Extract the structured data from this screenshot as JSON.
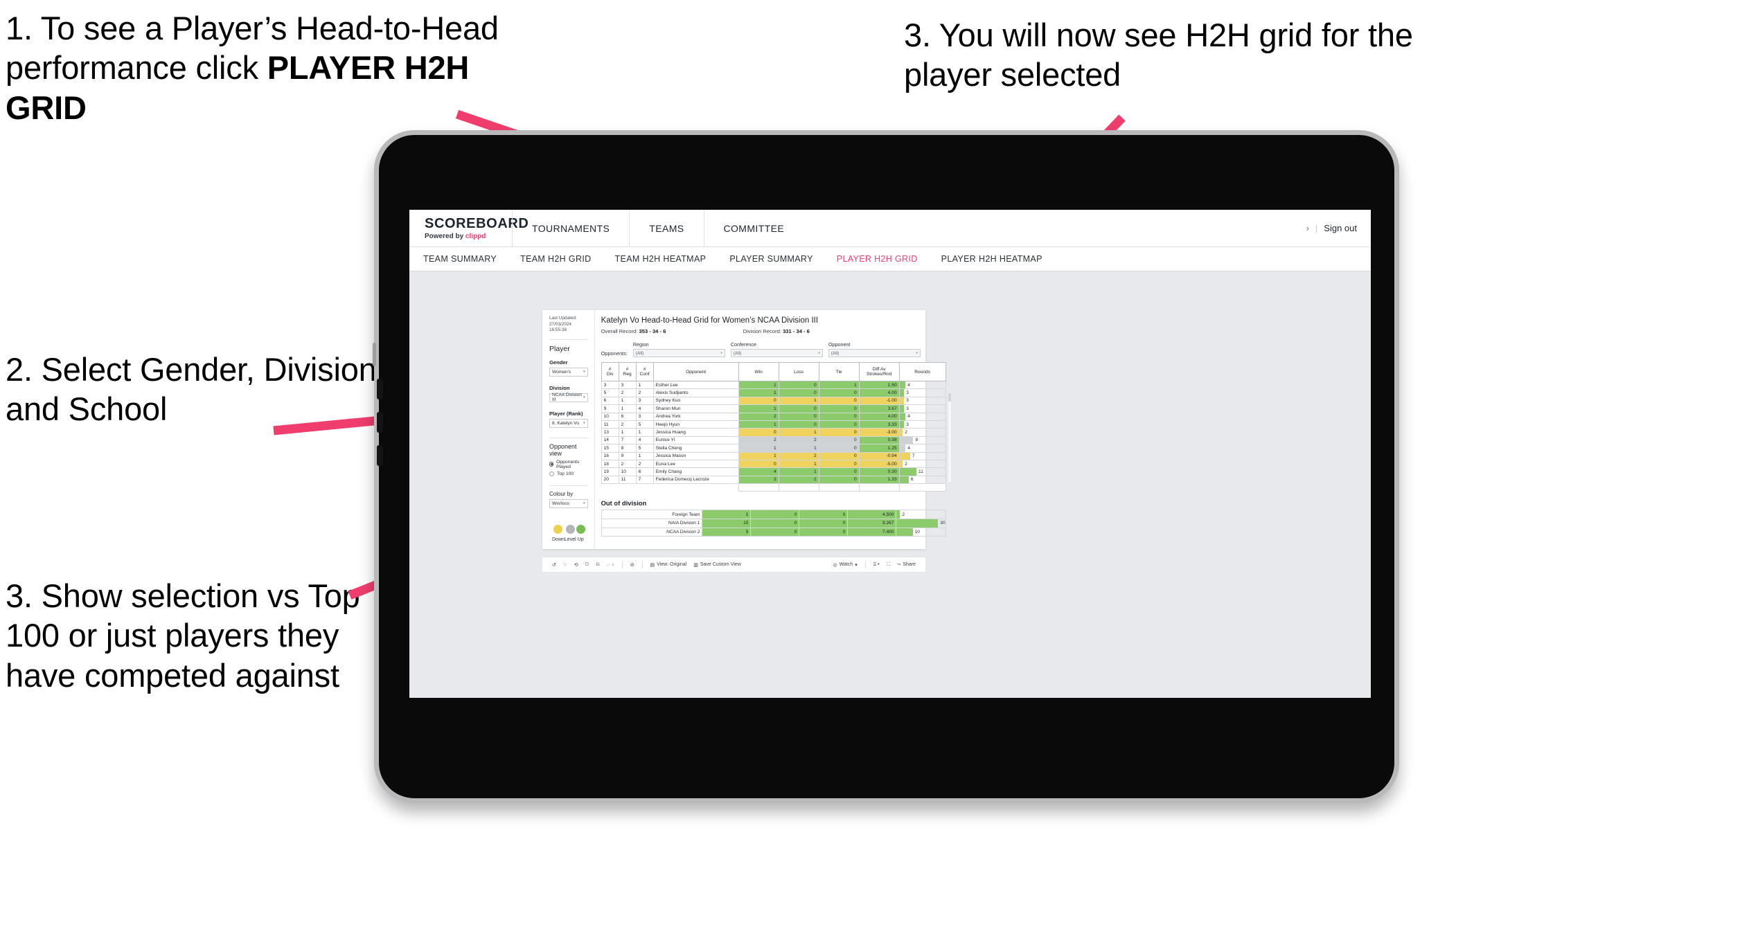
{
  "annotations": [
    {
      "id": "note-1",
      "text_plain": "1. To see a Player’s Head-to-Head performance click ",
      "text_bold": "PLAYER H2H GRID"
    },
    {
      "id": "note-2",
      "text": "3. You will now see H2H grid for the player selected"
    },
    {
      "id": "note-3",
      "text": "2. Select Gender, Division and School"
    },
    {
      "id": "note-4",
      "text": "3. Show selection vs Top 100 or just players they have competed against"
    }
  ],
  "accent_pink": "#ef3e6d",
  "app": {
    "brand": {
      "name": "SCOREBOARD",
      "powered_prefix": "Powered by",
      "powered_brand": "clippd"
    },
    "top_nav": [
      {
        "label": "TOURNAMENTS"
      },
      {
        "label": "TEAMS"
      },
      {
        "label": "COMMITTEE"
      }
    ],
    "top_right": {
      "chevron": "›",
      "separator": "|",
      "sign_out": "Sign out"
    },
    "sub_nav": [
      {
        "label": "TEAM SUMMARY",
        "active": false
      },
      {
        "label": "TEAM H2H GRID",
        "active": false
      },
      {
        "label": "TEAM H2H HEATMAP",
        "active": false
      },
      {
        "label": "PLAYER SUMMARY",
        "active": false
      },
      {
        "label": "PLAYER H2H GRID",
        "active": true
      },
      {
        "label": "PLAYER H2H HEATMAP",
        "active": false
      }
    ]
  },
  "filters": {
    "last_updated_line1": "Last Updated: 27/03/2024",
    "last_updated_line2": "16:55:38",
    "player_heading": "Player",
    "gender": {
      "label": "Gender",
      "value": "Women's"
    },
    "division": {
      "label": "Division",
      "value": "NCAA Division III"
    },
    "player_rank": {
      "label": "Player (Rank)",
      "value": "8. Katelyn Vo"
    },
    "opponent_view": {
      "heading": "Opponent view",
      "options": [
        {
          "label": "Opponents Played",
          "selected": true
        },
        {
          "label": "Top 100",
          "selected": false
        }
      ]
    },
    "colour_by": {
      "label": "Colour by",
      "value": "Win/loss"
    },
    "legend": [
      {
        "label": "Down",
        "color": "#ecd24a"
      },
      {
        "label": "Level",
        "color": "#b4b7ba"
      },
      {
        "label": "Up",
        "color": "#76bd53"
      }
    ]
  },
  "view": {
    "title": "Katelyn Vo Head-to-Head Grid for Women’s NCAA Division III",
    "overall_record_label": "Overall Record:",
    "overall_record_value": "353 - 34 - 6",
    "division_record_label": "Division Record:",
    "division_record_value": "331 - 34 - 6",
    "opponents_label": "Opponents:",
    "opponent_filters": [
      {
        "label": "Region",
        "value": "(All)"
      },
      {
        "label": "Conference",
        "value": "(All)"
      },
      {
        "label": "Opponent",
        "value": "(All)"
      }
    ],
    "out_of_division_heading": "Out of division"
  },
  "chart_data": {
    "type": "table",
    "title": "Katelyn Vo Head-to-Head Grid for Women’s NCAA Division III",
    "columns": [
      "# Div",
      "# Reg",
      "# Conf",
      "Opponent",
      "Win",
      "Loss",
      "Tie",
      "Diff Av Strokes/Rnd",
      "Rounds"
    ],
    "column_header_lines": [
      [
        "#",
        "Div"
      ],
      [
        "#",
        "Reg"
      ],
      [
        "#",
        "Conf"
      ],
      [
        "Opponent"
      ],
      [
        "Win"
      ],
      [
        "Loss"
      ],
      [
        "Tie"
      ],
      [
        "Diff Av",
        "Strokes/Rnd"
      ],
      [
        "Rounds"
      ]
    ],
    "rounds_max": 30,
    "rows": [
      {
        "div": "3",
        "reg": "3",
        "conf": "1",
        "opponent": "Esther Lee",
        "win": "1",
        "loss": "0",
        "tie": "1",
        "diff": "1.50",
        "rounds": 4,
        "status": "up"
      },
      {
        "div": "5",
        "reg": "2",
        "conf": "2",
        "opponent": "Alexis Sudjianto",
        "win": "1",
        "loss": "0",
        "tie": "0",
        "diff": "4.00",
        "rounds": 3,
        "status": "up"
      },
      {
        "div": "6",
        "reg": "1",
        "conf": "3",
        "opponent": "Sydney Kuo",
        "win": "0",
        "loss": "1",
        "tie": "0",
        "diff": "-1.00",
        "rounds": 3,
        "status": "down"
      },
      {
        "div": "9",
        "reg": "1",
        "conf": "4",
        "opponent": "Sharon Mun",
        "win": "1",
        "loss": "0",
        "tie": "0",
        "diff": "3.67",
        "rounds": 3,
        "status": "up"
      },
      {
        "div": "10",
        "reg": "6",
        "conf": "3",
        "opponent": "Andrea York",
        "win": "2",
        "loss": "0",
        "tie": "0",
        "diff": "4.00",
        "rounds": 4,
        "status": "up"
      },
      {
        "div": "11",
        "reg": "2",
        "conf": "5",
        "opponent": "Heejo Hyun",
        "win": "1",
        "loss": "0",
        "tie": "0",
        "diff": "3.33",
        "rounds": 3,
        "status": "up"
      },
      {
        "div": "13",
        "reg": "1",
        "conf": "1",
        "opponent": "Jessica Huang",
        "win": "0",
        "loss": "1",
        "tie": "0",
        "diff": "-3.00",
        "rounds": 2,
        "status": "down"
      },
      {
        "div": "14",
        "reg": "7",
        "conf": "4",
        "opponent": "Eunice Yi",
        "win": "2",
        "loss": "2",
        "tie": "0",
        "diff": "0.38",
        "rounds": 9,
        "status": "level",
        "diff_status": "up"
      },
      {
        "div": "15",
        "reg": "8",
        "conf": "5",
        "opponent": "Stella Cheng",
        "win": "1",
        "loss": "1",
        "tie": "0",
        "diff": "1.25",
        "rounds": 4,
        "status": "level",
        "diff_status": "up"
      },
      {
        "div": "16",
        "reg": "9",
        "conf": "1",
        "opponent": "Jessica Mason",
        "win": "1",
        "loss": "2",
        "tie": "0",
        "diff": "-0.94",
        "rounds": 7,
        "status": "down"
      },
      {
        "div": "18",
        "reg": "2",
        "conf": "2",
        "opponent": "Euna Lee",
        "win": "0",
        "loss": "1",
        "tie": "0",
        "diff": "-5.00",
        "rounds": 2,
        "status": "down"
      },
      {
        "div": "19",
        "reg": "10",
        "conf": "6",
        "opponent": "Emily Chang",
        "win": "4",
        "loss": "1",
        "tie": "0",
        "diff": "0.30",
        "rounds": 11,
        "status": "up"
      },
      {
        "div": "20",
        "reg": "11",
        "conf": "7",
        "opponent": "Federica Domecq Lacroze",
        "win": "2",
        "loss": "1",
        "tie": "0",
        "diff": "1.33",
        "rounds": 6,
        "status": "up"
      }
    ],
    "out_of_division_rows": [
      {
        "label": "Foreign Team",
        "win": "1",
        "loss": "0",
        "tie": "0",
        "diff": "4.500",
        "rounds": 2,
        "status": "up"
      },
      {
        "label": "NAIA Division 1",
        "win": "15",
        "loss": "0",
        "tie": "0",
        "diff": "9.267",
        "rounds": 30,
        "status": "up"
      },
      {
        "label": "NCAA Division 2",
        "win": "5",
        "loss": "0",
        "tie": "0",
        "diff": "7.400",
        "rounds": 10,
        "status": "up"
      }
    ]
  },
  "toolbar": {
    "view_label": "View: Original",
    "save_label": "Save Custom View",
    "watch_label": "Watch",
    "share_label": "Share"
  }
}
